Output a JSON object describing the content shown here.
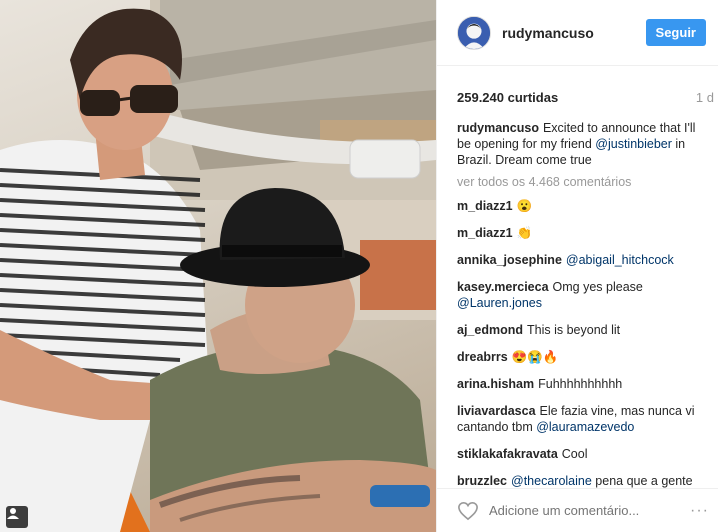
{
  "post": {
    "username": "rudymancuso",
    "follow_label": "Seguir",
    "likes": "259.240 curtidas",
    "time": "1 d",
    "caption": {
      "author": "rudymancuso",
      "text_before": "Excited to announce that I'll be opening for my friend ",
      "mention": "@justinbieber",
      "text_after": " in Brazil. Dream come true"
    },
    "view_all": "ver todos os 4.468 comentários",
    "comments": [
      {
        "author": "m_diazz1",
        "text": "😮",
        "mention": ""
      },
      {
        "author": "m_diazz1",
        "text": "👏",
        "mention": ""
      },
      {
        "author": "annika_josephine",
        "text": "",
        "mention": "@abigail_hitchcock"
      },
      {
        "author": "kasey.mercieca",
        "text": "Omg yes please ",
        "mention": "@Lauren.jones"
      },
      {
        "author": "aj_edmond",
        "text": "This is beyond lit",
        "mention": ""
      },
      {
        "author": "dreabrrs",
        "text": "😍😭🔥",
        "mention": ""
      },
      {
        "author": "arina.hisham",
        "text": "Fuhhhhhhhhhh",
        "mention": ""
      },
      {
        "author": "liviavardasca",
        "text": "Ele fazia vine, mas nunca vi cantando tbm ",
        "mention": "@lauramazevedo"
      },
      {
        "author": "stiklakafakravata",
        "text": "Cool",
        "mention": ""
      },
      {
        "author": "bruzzlec",
        "text": " pena que a gente não vai.. 😱😳😭",
        "mention": "@thecarolaine",
        "mention_first": true
      }
    ],
    "comment_placeholder": "Adicione um comentário...",
    "more_label": "···"
  },
  "colors": {
    "accent": "#3897f0",
    "mention": "#003569",
    "muted": "#999999"
  },
  "icons": {
    "heart": "heart-icon",
    "avatar": "user-avatar-icon",
    "badge": "user-tag-icon"
  }
}
